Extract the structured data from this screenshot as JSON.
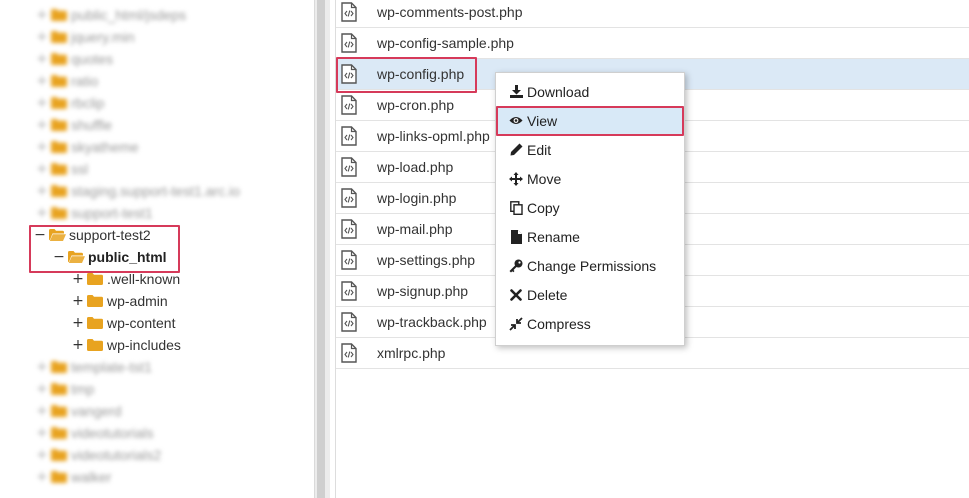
{
  "tree": {
    "items": [
      {
        "label": "public_html/jsdeps",
        "toggle": "+",
        "blurred": true
      },
      {
        "label": "jquery.min",
        "toggle": "+",
        "blurred": true
      },
      {
        "label": "quotes",
        "toggle": "+",
        "blurred": true
      },
      {
        "label": "ratio",
        "toggle": "+",
        "blurred": true
      },
      {
        "label": "rbclip",
        "toggle": "+",
        "blurred": true
      },
      {
        "label": "shuffle",
        "toggle": "+",
        "blurred": true
      },
      {
        "label": "skyatheme",
        "toggle": "+",
        "blurred": true
      },
      {
        "label": "ssl",
        "toggle": "+",
        "blurred": true
      },
      {
        "label": "staging.support-test1.arc.io",
        "toggle": "+",
        "blurred": true
      },
      {
        "label": "support-test1",
        "toggle": "+",
        "blurred": true
      },
      {
        "label": "support-test2",
        "toggle": "−",
        "blurred": false
      },
      {
        "label": "public_html",
        "toggle": "−",
        "blurred": false
      },
      {
        "label": ".well-known",
        "toggle": "+",
        "blurred": false
      },
      {
        "label": "wp-admin",
        "toggle": "+",
        "blurred": false
      },
      {
        "label": "wp-content",
        "toggle": "+",
        "blurred": false
      },
      {
        "label": "wp-includes",
        "toggle": "+",
        "blurred": false
      },
      {
        "label": "template-tst1",
        "toggle": "+",
        "blurred": true
      },
      {
        "label": "tmp",
        "toggle": "+",
        "blurred": true
      },
      {
        "label": "vangerd",
        "toggle": "+",
        "blurred": true
      },
      {
        "label": "videotutorials",
        "toggle": "+",
        "blurred": true
      },
      {
        "label": "videotutorials2",
        "toggle": "+",
        "blurred": true
      },
      {
        "label": "walker",
        "toggle": "+",
        "blurred": true
      }
    ]
  },
  "files": [
    "wp-comments-post.php",
    "wp-config-sample.php",
    "wp-config.php",
    "wp-cron.php",
    "wp-links-opml.php",
    "wp-load.php",
    "wp-login.php",
    "wp-mail.php",
    "wp-settings.php",
    "wp-signup.php",
    "wp-trackback.php",
    "xmlrpc.php"
  ],
  "selected_file_index": 2,
  "context_menu": {
    "items": [
      {
        "label": "Download",
        "icon": "download-icon"
      },
      {
        "label": "View",
        "icon": "eye-icon"
      },
      {
        "label": "Edit",
        "icon": "pencil-icon"
      },
      {
        "label": "Move",
        "icon": "move-icon"
      },
      {
        "label": "Copy",
        "icon": "copy-icon"
      },
      {
        "label": "Rename",
        "icon": "file-icon"
      },
      {
        "label": "Change Permissions",
        "icon": "key-icon"
      },
      {
        "label": "Delete",
        "icon": "x-icon"
      },
      {
        "label": "Compress",
        "icon": "compress-icon"
      }
    ],
    "active_index": 1
  },
  "colors": {
    "folder": "#e8a320",
    "highlight_border": "#d63a5a",
    "selection": "#dbe9f6"
  }
}
